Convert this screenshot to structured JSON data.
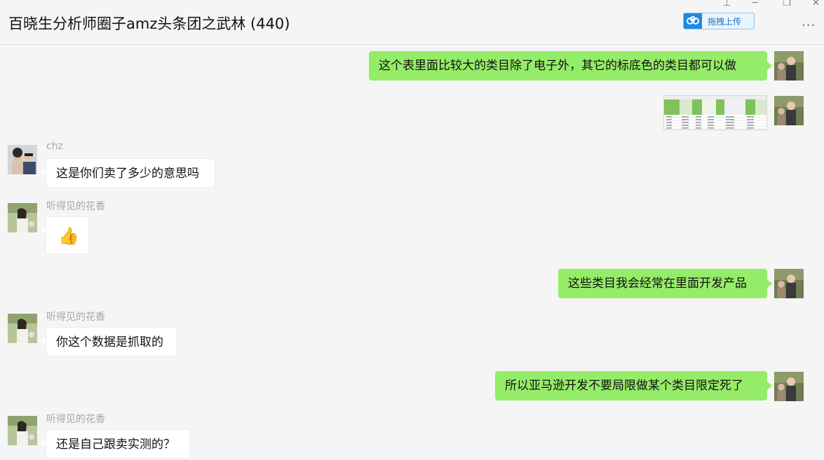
{
  "window": {
    "title": "百晓生分析师圈子amz头条团之武林 (440)",
    "upload_label": "拖拽上传",
    "more_label": "···",
    "pin_glyph": "⊥",
    "minimize_glyph": "─",
    "restore_glyph": "❐",
    "close_glyph": "✕"
  },
  "messages": [
    {
      "from": "me",
      "text": "这个表里面比较大的类目除了电子外，其它的标底色的类目都可以做"
    },
    {
      "from": "me",
      "type": "image"
    },
    {
      "from": "chz",
      "sender": "chz",
      "text": "这是你们卖了多少的意思吗"
    },
    {
      "from": "listener",
      "sender": "听得见的花香",
      "type": "emoji",
      "emoji": "👍"
    },
    {
      "from": "me",
      "text": "这些类目我会经常在里面开发产品"
    },
    {
      "from": "listener",
      "sender": "听得见的花香",
      "text": "你这个数据是抓取的"
    },
    {
      "from": "me",
      "text": "所以亚马逊开发不要局限做某个类目限定死了"
    },
    {
      "from": "listener",
      "sender": "听得见的花香",
      "text": "还是自己跟卖实测的？"
    }
  ],
  "colors": {
    "my_bubble": "#95ec69",
    "their_bubble": "#ffffff",
    "background": "#f5f5f5",
    "upload_accent": "#1e88e5"
  }
}
